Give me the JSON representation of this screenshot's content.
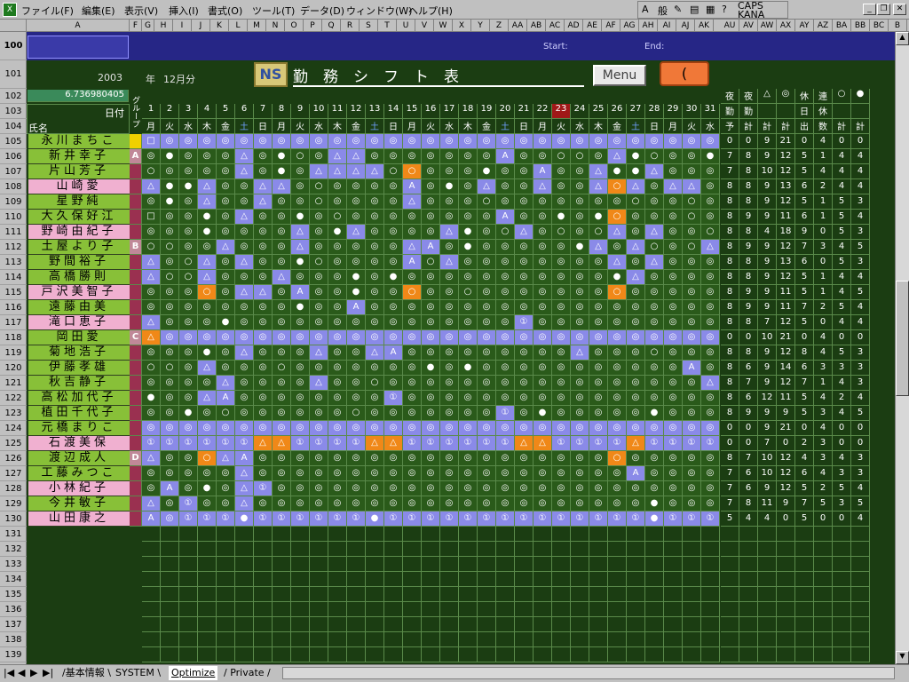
{
  "menu": [
    "ファイル(F)",
    "編集(E)",
    "表示(V)",
    "挿入(I)",
    "書式(O)",
    "ツール(T)",
    "データ(D)",
    "ウィンドウ(W)",
    "ヘルプ(H)"
  ],
  "ime": {
    "mode": "A",
    "kanji": "般",
    "caps": "CAPS",
    "kana": "KANA"
  },
  "columns": [
    "A",
    "F",
    "G",
    "H",
    "I",
    "J",
    "K",
    "L",
    "M",
    "N",
    "O",
    "P",
    "Q",
    "R",
    "S",
    "T",
    "U",
    "V",
    "W",
    "X",
    "Y",
    "Z",
    "AA",
    "AB",
    "AC",
    "AD",
    "AE",
    "AF",
    "AG",
    "AH",
    "AI",
    "AJ",
    "AK",
    "AU",
    "AV",
    "AW",
    "AX",
    "AY",
    "AZ",
    "BA",
    "BB",
    "BC",
    "B"
  ],
  "header": {
    "start_label": "Start:",
    "end_label": "End:",
    "year": "2003",
    "year_unit": "年",
    "month": "12月分",
    "ns": "NS",
    "title": "勤　務　シ　フ　ト　表",
    "menu_button": "Menu",
    "orange_button": "(",
    "value": "6.736980405",
    "day_label": "日付",
    "name_label": "氏名",
    "group_label": "グループ"
  },
  "days": [
    "1",
    "2",
    "3",
    "4",
    "5",
    "6",
    "7",
    "8",
    "9",
    "10",
    "11",
    "12",
    "13",
    "14",
    "15",
    "16",
    "17",
    "18",
    "19",
    "20",
    "21",
    "22",
    "23",
    "24",
    "25",
    "26",
    "27",
    "28",
    "29",
    "30",
    "31"
  ],
  "weekdays": [
    "月",
    "火",
    "水",
    "木",
    "金",
    "土",
    "日",
    "月",
    "火",
    "水",
    "木",
    "金",
    "土",
    "日",
    "月",
    "火",
    "水",
    "木",
    "金",
    "土",
    "日",
    "月",
    "火",
    "水",
    "木",
    "金",
    "土",
    "日",
    "月",
    "火",
    "水"
  ],
  "sum_headers": [
    [
      "夜",
      "勤",
      "予"
    ],
    [
      "夜",
      "勤",
      "計"
    ],
    [
      "△",
      "",
      "計"
    ],
    [
      "◎",
      "",
      "計"
    ],
    [
      "休",
      "日",
      "出"
    ],
    [
      "連",
      "休",
      "数"
    ],
    [
      "○",
      "",
      "計"
    ],
    [
      "●",
      "",
      "計"
    ]
  ],
  "groups": {
    "A": "A",
    "B": "B",
    "C": "C",
    "D": "D"
  },
  "staff": [
    {
      "name": "永川まちこ",
      "g": "",
      "pink": false,
      "band": true,
      "sums": [
        "0",
        "0",
        "9",
        "21",
        "0",
        "4",
        "0",
        "0"
      ],
      "s": "□◎◎◎◎◎◎◎◎◎◎◎◎◎◎◎◎◎◎◎◎◎◎◎◎◎◎◎◎◎◎"
    },
    {
      "name": "新井幸子",
      "g": "A",
      "pink": false,
      "band": false,
      "sums": [
        "7",
        "8",
        "9",
        "12",
        "5",
        "1",
        "4",
        "4"
      ],
      "s": "◎●◎◎◎△◎●○◎△△◎◎◎◎◎◎◎A◎◎○○◎△●○◎◎●"
    },
    {
      "name": "片山芳子",
      "g": "",
      "pink": false,
      "band": false,
      "sums": [
        "7",
        "8",
        "10",
        "12",
        "5",
        "4",
        "4",
        "4"
      ],
      "s": "○◎◎◎◎△◎●◎△△△△○○◎◎◎●◎◎A◎◎△●●△◎◎◎"
    },
    {
      "name": "山崎愛",
      "g": "",
      "pink": true,
      "band": false,
      "sums": [
        "8",
        "8",
        "9",
        "13",
        "6",
        "2",
        "4",
        "4"
      ],
      "s": "△●●△◎◎△△◎○◎◎◎◎A◎●◎△◎◎△◎◎△○△◎△△◎"
    },
    {
      "name": "星野純",
      "g": "",
      "pink": false,
      "band": false,
      "sums": [
        "8",
        "8",
        "9",
        "12",
        "5",
        "1",
        "5",
        "3"
      ],
      "s": "◎●◎△◎◎△◎◎○◎◎◎◎△◎◎◎○◎◎◎◎◎◎◎○◎◎○◎"
    },
    {
      "name": "大久保好江",
      "g": "",
      "pink": false,
      "band": false,
      "sums": [
        "8",
        "9",
        "9",
        "11",
        "6",
        "1",
        "5",
        "4"
      ],
      "s": "□◎◎●◎△◎◎●◎○◎◎◎◎◎◎◎◎A◎◎●◎●○◎◎◎○◎"
    },
    {
      "name": "野崎由紀子",
      "g": "",
      "pink": true,
      "band": false,
      "sums": [
        "8",
        "8",
        "4",
        "18",
        "9",
        "0",
        "5",
        "3"
      ],
      "s": "◎◎◎●◎◎◎◎△◎●△◎◎◎◎△●◎○△◎○◎○△◎△◎◎○"
    },
    {
      "name": "土屋より子",
      "g": "B",
      "pink": false,
      "band": false,
      "sums": [
        "8",
        "9",
        "9",
        "12",
        "7",
        "3",
        "4",
        "5"
      ],
      "s": "○○◎◎△◎◎◎△◎◎◎◎◎△A◎●◎◎◎◎◎●△◎△○◎○△"
    },
    {
      "name": "野間裕子",
      "g": "",
      "pink": false,
      "band": false,
      "sums": [
        "8",
        "8",
        "9",
        "13",
        "6",
        "0",
        "5",
        "3"
      ],
      "s": "△◎○△◎△◎◎●○◎◎◎◎A○△◎◎◎◎◎◎◎◎△◎△◎◎◎"
    },
    {
      "name": "高橋勝則",
      "g": "",
      "pink": false,
      "band": false,
      "sums": [
        "8",
        "8",
        "9",
        "12",
        "5",
        "1",
        "4",
        "4"
      ],
      "s": "△○○△◎◎◎△◎◎◎●◎●◎◎◎◎◎◎◎◎◎◎◎●△◎◎◎◎"
    },
    {
      "name": "戸沢美智子",
      "g": "",
      "pink": true,
      "band": false,
      "sums": [
        "8",
        "9",
        "9",
        "11",
        "5",
        "1",
        "4",
        "5"
      ],
      "s": "◎◎◎○◎△△◎A◎◎●◎◎○◎◎○◎◎◎◎◎◎◎○◎◎◎◎◎"
    },
    {
      "name": "遠藤由美",
      "g": "",
      "pink": false,
      "band": false,
      "sums": [
        "8",
        "9",
        "9",
        "11",
        "7",
        "2",
        "5",
        "4"
      ],
      "s": "◎◎◎◎◎◎◎◎●◎◎A◎◎◎◎◎◎◎◎◎◎◎◎◎◎◎◎◎◎◎"
    },
    {
      "name": "滝口恵子",
      "g": "",
      "pink": true,
      "band": false,
      "sums": [
        "8",
        "8",
        "7",
        "12",
        "5",
        "0",
        "4",
        "4"
      ],
      "s": "△◎◎◎●◎◎◎◎◎◎◎◎◎◎◎◎◎◎◎①◎◎◎◎◎◎◎◎◎◎"
    },
    {
      "name": "岡田愛",
      "g": "C",
      "pink": false,
      "band": true,
      "sums": [
        "0",
        "0",
        "10",
        "21",
        "0",
        "4",
        "0",
        "0"
      ],
      "s": "△◎◎◎◎◎◎◎◎◎◎◎◎◎◎◎◎◎◎◎◎◎◎◎◎◎◎◎◎◎◎"
    },
    {
      "name": "菊地浩子",
      "g": "",
      "pink": false,
      "band": false,
      "sums": [
        "8",
        "8",
        "9",
        "12",
        "8",
        "4",
        "5",
        "3"
      ],
      "s": "◎◎◎●◎△◎◎◎△◎◎△A◎◎◎◎◎◎◎◎◎△◎◎◎○◎◎◎"
    },
    {
      "name": "伊藤孝雄",
      "g": "",
      "pink": false,
      "band": false,
      "sums": [
        "8",
        "6",
        "9",
        "14",
        "6",
        "3",
        "3",
        "3"
      ],
      "s": "○○◎△◎◎◎○◎◎◎◎◎◎◎●◎●◎◎◎◎◎◎◎◎◎◎◎A◎"
    },
    {
      "name": "秋吉静子",
      "g": "",
      "pink": false,
      "band": false,
      "sums": [
        "8",
        "7",
        "9",
        "12",
        "7",
        "1",
        "4",
        "3"
      ],
      "s": "◎◎◎◎△◎◎◎◎△◎◎○◎◎◎◎◎◎◎◎◎◎◎◎◎◎◎◎◎△"
    },
    {
      "name": "高松加代子",
      "g": "",
      "pink": false,
      "band": false,
      "sums": [
        "8",
        "6",
        "12",
        "11",
        "5",
        "4",
        "2",
        "4"
      ],
      "s": "●◎◎△A◎◎◎◎◎◎◎◎①◎◎◎◎◎◎◎◎◎◎◎◎◎◎◎◎◎"
    },
    {
      "name": "植田千代子",
      "g": "",
      "pink": false,
      "band": false,
      "sums": [
        "8",
        "9",
        "9",
        "9",
        "5",
        "3",
        "4",
        "5"
      ],
      "s": "◎◎●◎○◎◎◎◎◎◎○◎◎◎◎◎◎◎①◎●◎◎◎◎◎●◎◎◎"
    },
    {
      "name": "元橋まりこ",
      "g": "",
      "pink": false,
      "band": true,
      "sums": [
        "0",
        "0",
        "9",
        "21",
        "0",
        "4",
        "0",
        "0"
      ],
      "s": "◎◎◎◎◎◎◎◎◎◎◎◎◎◎◎◎◎◎◎◎◎◎◎◎◎◎◎◎◎◎◎"
    },
    {
      "name": "石渡美保",
      "g": "",
      "pink": true,
      "band": true,
      "sums": [
        "0",
        "0",
        "7",
        "0",
        "2",
        "3",
        "0",
        "0"
      ],
      "s": "①①①①①①△△①①①①△△①①①①①①△△①①①①△①①①①"
    },
    {
      "name": "渡辺成人",
      "g": "D",
      "pink": false,
      "band": false,
      "sums": [
        "8",
        "7",
        "10",
        "12",
        "4",
        "3",
        "4",
        "3"
      ],
      "s": "△◎◎○△A◎◎◎◎◎◎◎◎◎◎◎◎◎◎◎◎◎◎◎○◎◎◎◎◎"
    },
    {
      "name": "工藤みつこ",
      "g": "",
      "pink": false,
      "band": false,
      "sums": [
        "7",
        "6",
        "10",
        "12",
        "6",
        "4",
        "3",
        "3"
      ],
      "s": "◎◎◎◎◎△◎◎◎◎◎◎◎◎◎◎◎◎◎◎◎◎◎◎◎◎A◎◎◎◎"
    },
    {
      "name": "小林紀子",
      "g": "",
      "pink": true,
      "band": false,
      "sums": [
        "7",
        "6",
        "9",
        "12",
        "5",
        "2",
        "5",
        "4"
      ],
      "s": "◎A◎●◎△①◎◎◎◎◎◎◎◎◎◎◎◎◎◎◎◎◎◎◎◎◎◎◎◎"
    },
    {
      "name": "今井敏子",
      "g": "",
      "pink": false,
      "band": false,
      "sums": [
        "7",
        "8",
        "11",
        "9",
        "7",
        "5",
        "3",
        "5"
      ],
      "s": "△◎①◎◎△◎◎◎◎◎◎◎◎◎◎◎◎◎◎◎◎◎◎◎◎◎●◎◎◎"
    },
    {
      "name": "山田康之",
      "g": "",
      "pink": true,
      "band": true,
      "sums": [
        "5",
        "4",
        "4",
        "0",
        "5",
        "0",
        "0",
        "4"
      ],
      "s": "A◎①①①●①①①①①①●①①①①①①①①①①①①①①●①①①"
    }
  ]
}
